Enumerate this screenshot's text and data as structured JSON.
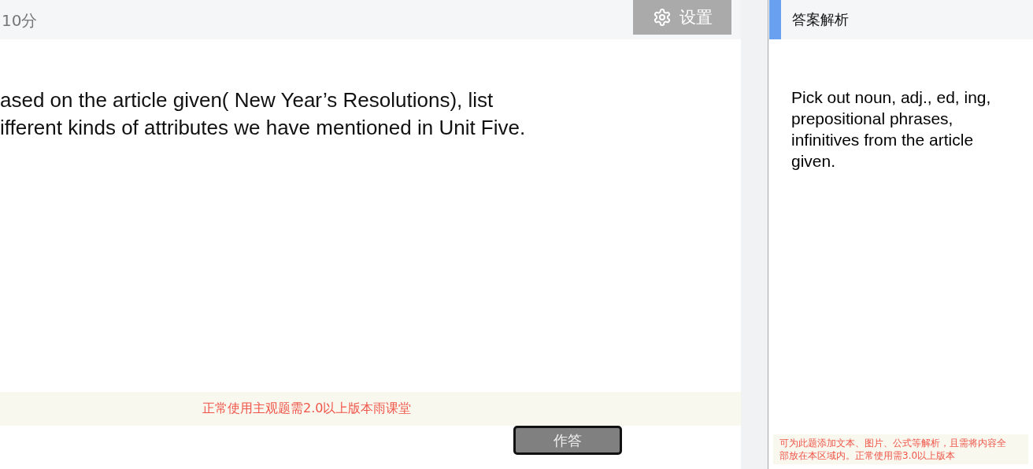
{
  "question": {
    "score": "10分",
    "settings_button": "设置",
    "text_lines": [
      "ased on the article given( New Year’s Resolutions), list",
      "ifferent kinds of attributes we have mentioned in Unit Five."
    ],
    "notice": "正常使用主观题需2.0以上版本雨课堂",
    "answer_button": "作答"
  },
  "analysis": {
    "title": "答案解析",
    "body": "Pick out noun, adj., ed, ing, prepositional phrases, infinitives from the article given.",
    "notice": "可为此题添加文本、图片、公式等解析，且需将内容全部放在本区域内。正常使用需3.0以上版本"
  }
}
